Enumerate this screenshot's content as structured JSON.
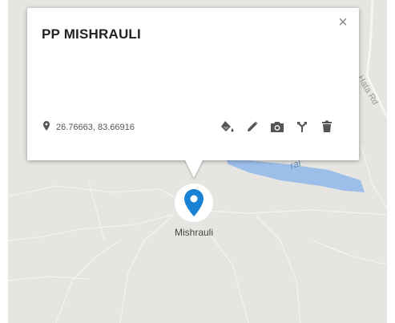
{
  "map": {
    "road_label": "Hata Rd",
    "canal_label": "ral",
    "place_label": "Mishrauli"
  },
  "popup": {
    "title": "PP MISHRAULI",
    "close_glyph": "×",
    "coordinates": "26.76663, 83.66916"
  },
  "icons": {
    "coordinates": "location-pin-icon",
    "tools": [
      "paint-bucket-icon",
      "pencil-icon",
      "camera-icon",
      "directions-fork-icon",
      "trash-icon"
    ],
    "marker": "map-marker-icon"
  },
  "colors": {
    "marker": "#1a82d4",
    "water": "#9cbfea",
    "map_background": "#e7e5e1",
    "tool_icon": "#555555"
  }
}
